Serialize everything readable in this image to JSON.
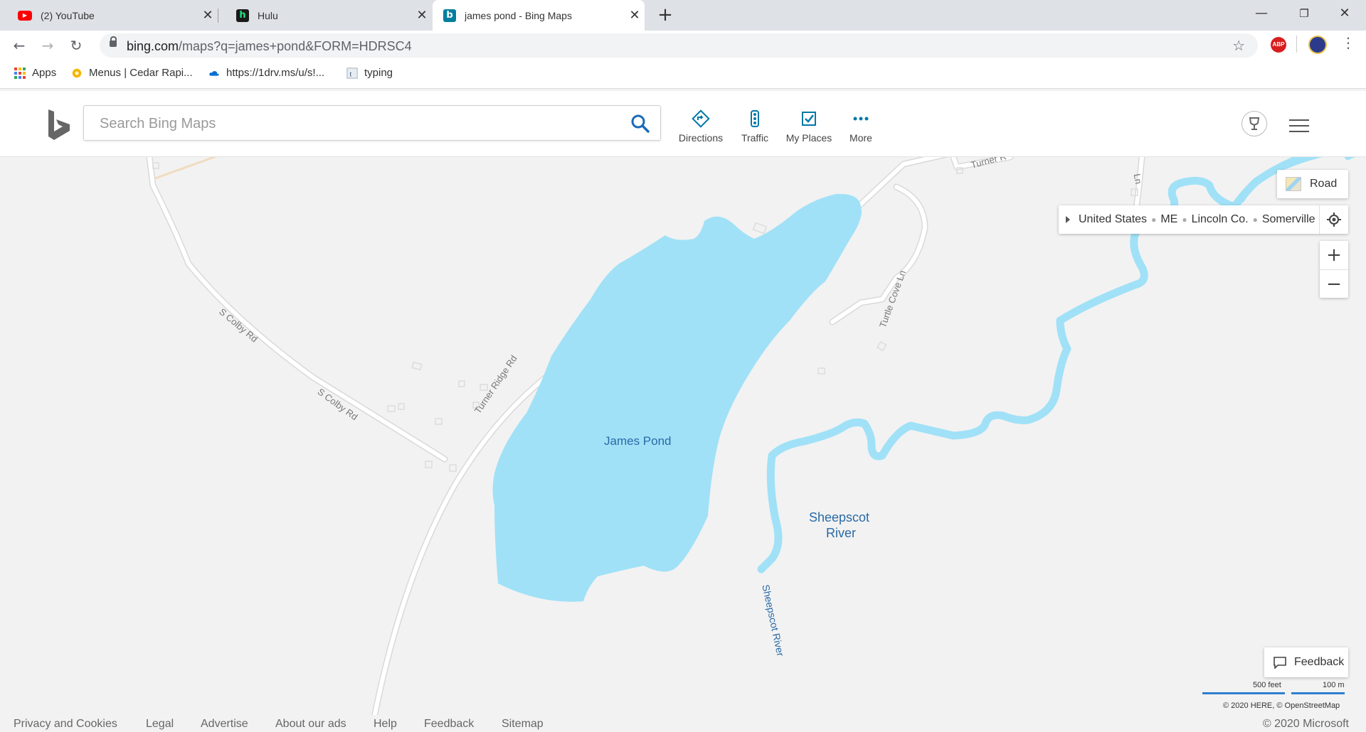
{
  "browser": {
    "tabs": [
      {
        "title": "(2) YouTube",
        "icon": "youtube-icon",
        "color": "#ff0000",
        "active": false
      },
      {
        "title": "Hulu",
        "icon": "hulu-icon",
        "color": "#1a1a1a",
        "active": false
      },
      {
        "title": "james pond - Bing Maps",
        "icon": "bing-icon",
        "color": "#00809d",
        "active": true
      }
    ],
    "url_host": "bing.com",
    "url_path": "/maps?q=james+pond&FORM=HDRSC4",
    "abp_label": "ABP",
    "bookmarks": [
      {
        "label": "Apps",
        "icon": "apps-grid-icon"
      },
      {
        "label": "Menus | Cedar Rapi...",
        "icon": "restaurant-icon"
      },
      {
        "label": "https://1drv.ms/u/s!...",
        "icon": "onedrive-icon"
      },
      {
        "label": "typing",
        "icon": "typing-icon"
      }
    ]
  },
  "bing": {
    "search_placeholder": "Search Bing Maps",
    "nav": {
      "directions": "Directions",
      "traffic": "Traffic",
      "my_places": "My Places",
      "more": "More"
    }
  },
  "map": {
    "labels": {
      "lake": "James Pond",
      "river_line1": "Sheepscot",
      "river_line2": "River",
      "river_vertical": "Sheepscot River"
    },
    "roads": {
      "colby1": "S Colby Rd",
      "colby2": "S Colby Rd",
      "turner_ridge": "Turner Ridge Rd",
      "turtle_cove": "Turtle Cove Ln",
      "turner_top": "Turner R",
      "ln_top": "Ln"
    },
    "style_button": "Road",
    "breadcrumb": [
      "United States",
      "ME",
      "Lincoln Co.",
      "Somerville"
    ],
    "feedback": "Feedback",
    "scale_imperial": "500 feet",
    "scale_metric": "100 m",
    "attribution": "© 2020 HERE, © OpenStreetMap",
    "colors": {
      "water": "#a0e1f7",
      "land": "#f2f2f2",
      "road": "#ffffff",
      "label": "#2a6aa6"
    }
  },
  "footer": {
    "links": [
      "Privacy and Cookies",
      "Legal",
      "Advertise",
      "About our ads",
      "Help",
      "Feedback",
      "Sitemap"
    ],
    "copyright": "© 2020 Microsoft"
  }
}
